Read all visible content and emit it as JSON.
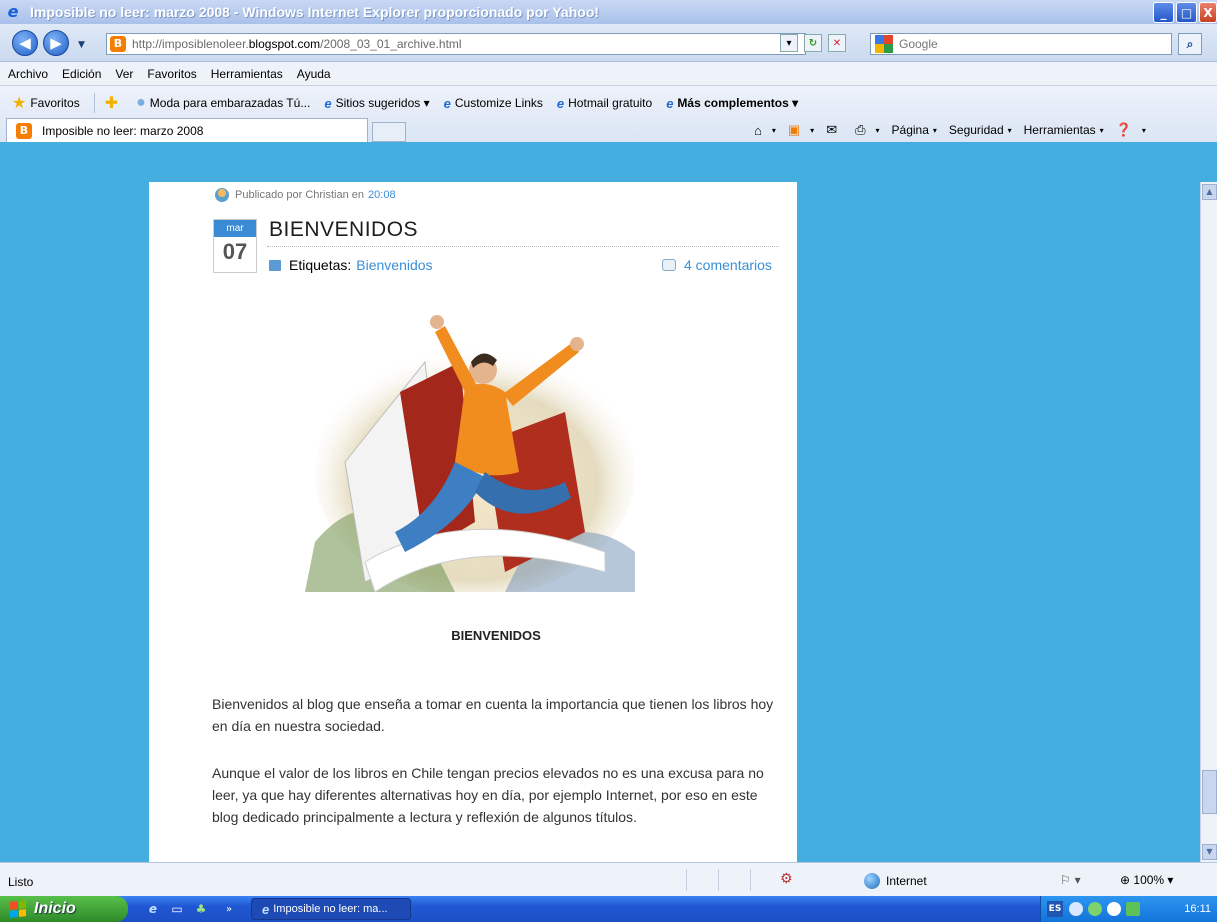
{
  "window": {
    "title": "Imposible no leer: marzo 2008 - Windows Internet Explorer proporcionado por Yahoo!",
    "minimize": "_",
    "maximize": "□",
    "close": "X"
  },
  "address_bar": {
    "url_prefix": "http://imposiblenoleer.",
    "url_domain": "blogspot.com",
    "url_path": "/2008_03_01_archive.html",
    "search_placeholder": "Google"
  },
  "menu": [
    "Archivo",
    "Edición",
    "Ver",
    "Favoritos",
    "Herramientas",
    "Ayuda"
  ],
  "favorites_bar": {
    "favorites_label": "Favoritos",
    "items": [
      {
        "label": "Moda para embarazadas Tú..."
      },
      {
        "label": "Sitios sugeridos ▾"
      },
      {
        "label": "Customize Links"
      },
      {
        "label": "Hotmail gratuito"
      },
      {
        "label": "Más complementos ▾"
      }
    ]
  },
  "tab": {
    "label": "Imposible no leer: marzo 2008"
  },
  "command_bar": {
    "page": "Página",
    "security": "Seguridad",
    "tools": "Herramientas"
  },
  "post": {
    "published": "Publicado por Christian en",
    "published_time": "20:08",
    "date_month": "mar",
    "date_day": "07",
    "title": "BIENVENIDOS",
    "labels_prefix": "Etiquetas:",
    "labels_link": "Bienvenidos",
    "comments": "4 comentarios",
    "center_heading": "BIENVENIDOS",
    "paragraphs": [
      "Bienvenidos al blog que enseña a tomar en cuenta la importancia que tienen los libros hoy en día en nuestra sociedad.",
      "Aunque el valor de los libros en Chile tengan precios elevados no es una excusa para no leer, ya que hay diferentes alternativas hoy en día, por ejemplo Internet, por eso en este blog dedicado principalmente a lectura y reflexión de algunos títulos."
    ]
  },
  "status_bar": {
    "status": "Listo",
    "zone": "Internet",
    "zoom": "100%"
  },
  "taskbar": {
    "start": "Inicio",
    "window_button": "Imposible no leer: ma...",
    "language": "ES",
    "clock": "16:11"
  },
  "colors": {
    "page_background": "#44aee0",
    "link": "#3a8fd6",
    "title_bar": "#a9c1ea"
  }
}
